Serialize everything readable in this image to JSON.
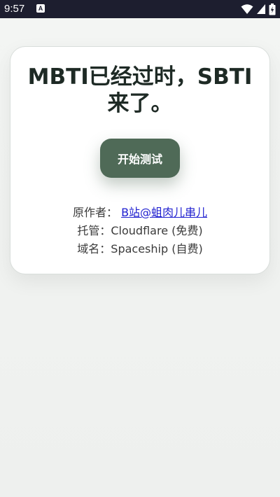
{
  "status_bar": {
    "time": "9:57",
    "notification_glyph": "A",
    "icons": [
      "notification-icon",
      "wifi-icon",
      "cellular-signal-icon",
      "battery-charging-icon"
    ]
  },
  "card": {
    "title_line1": "MBTI已经过时，SBTI",
    "title_line2": "来了。",
    "start_button": "开始测试",
    "author_label": "原作者：",
    "author_link": "B站@蛆肉儿串儿",
    "hosting": "托管：Cloudflare (免费)",
    "domain": "域名：Spaceship (自费)"
  },
  "colors": {
    "status_bar_bg": "#1d1e2f",
    "button_bg": "#4f6a57",
    "title_text": "#1e2a25",
    "link": "#2020d0"
  }
}
